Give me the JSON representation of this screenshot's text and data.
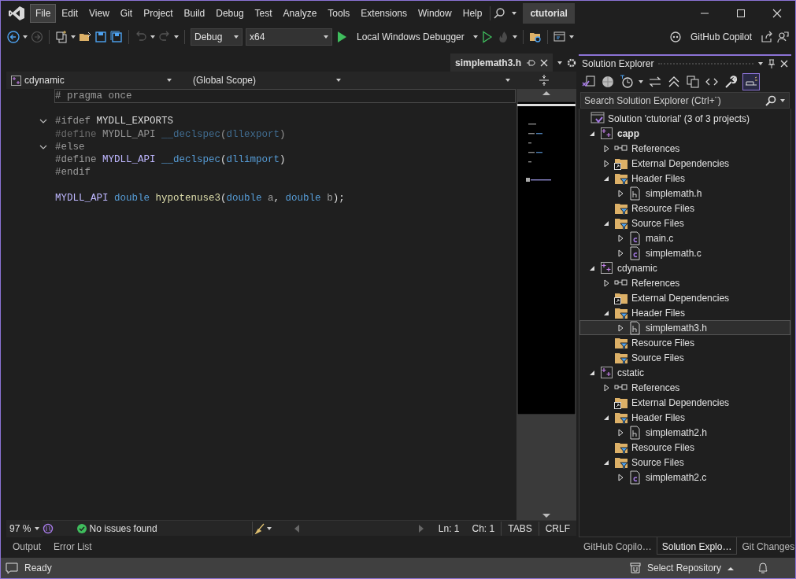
{
  "title_bar": {
    "menu": [
      {
        "label": "File",
        "selected": true
      },
      {
        "label": "Edit",
        "selected": false
      },
      {
        "label": "View",
        "selected": false
      },
      {
        "label": "Git",
        "selected": false
      },
      {
        "label": "Project",
        "selected": false
      },
      {
        "label": "Build",
        "selected": false
      },
      {
        "label": "Debug",
        "selected": false
      },
      {
        "label": "Test",
        "selected": false
      },
      {
        "label": "Analyze",
        "selected": false
      },
      {
        "label": "Tools",
        "selected": false
      },
      {
        "label": "Extensions",
        "selected": false
      },
      {
        "label": "Window",
        "selected": false
      },
      {
        "label": "Help",
        "selected": false
      }
    ],
    "solution_name": "ctutorial"
  },
  "toolbar": {
    "configuration": "Debug",
    "platform": "x64",
    "debugger": "Local Windows Debugger",
    "copilot": "GitHub Copilot"
  },
  "editor": {
    "tab": {
      "label": "simplemath3.h"
    },
    "navigation": [
      "cdynamic",
      "(Global Scope)"
    ],
    "lines": [
      {
        "current": true,
        "tokens": [
          {
            "text": "# pragma once",
            "kind": "preprocessor"
          }
        ]
      },
      {
        "space_before": true,
        "fold": true,
        "tokens": [
          {
            "text": "#ifdef ",
            "kind": "preprocessor"
          },
          {
            "text": "MYDLL_EXPORTS",
            "kind": "identifier"
          }
        ]
      },
      {
        "inactive": true,
        "tokens": [
          {
            "text": "#define ",
            "kind": "preprocessor"
          },
          {
            "text": "MYDLL_API ",
            "kind": "identifier"
          },
          {
            "text": "__declspec",
            "kind": "keyword"
          },
          {
            "text": "(",
            "kind": "plain"
          },
          {
            "text": "dllexport",
            "kind": "keyword"
          },
          {
            "text": ")",
            "kind": "plain"
          }
        ]
      },
      {
        "fold": true,
        "tokens": [
          {
            "text": "#else",
            "kind": "preprocessor"
          }
        ]
      },
      {
        "tokens": [
          {
            "text": "#define ",
            "kind": "preprocessor"
          },
          {
            "text": "MYDLL_API ",
            "kind": "macro"
          },
          {
            "text": "__declspec",
            "kind": "keyword"
          },
          {
            "text": "(",
            "kind": "plain"
          },
          {
            "text": "dllimport",
            "kind": "keyword"
          },
          {
            "text": ")",
            "kind": "plain"
          }
        ]
      },
      {
        "tokens": [
          {
            "text": "#endif",
            "kind": "preprocessor"
          }
        ]
      },
      {
        "space_before": true,
        "tokens": [
          {
            "text": "MYDLL_API ",
            "kind": "macro"
          },
          {
            "text": "double ",
            "kind": "keyword"
          },
          {
            "text": "hypotenuse3",
            "kind": "function"
          },
          {
            "text": "(",
            "kind": "plain"
          },
          {
            "text": "double ",
            "kind": "keyword"
          },
          {
            "text": "a",
            "kind": "parameter"
          },
          {
            "text": ", ",
            "kind": "plain"
          },
          {
            "text": "double ",
            "kind": "keyword"
          },
          {
            "text": "b",
            "kind": "parameter"
          },
          {
            "text": ");",
            "kind": "plain"
          }
        ]
      }
    ],
    "status": {
      "zoom": "97 %",
      "issues": "No issues found",
      "line": "Ln: 1",
      "column": "Ch: 1",
      "indent": "TABS",
      "line_endings": "CRLF"
    }
  },
  "bottom_tabs": [
    {
      "label": "Output"
    },
    {
      "label": "Error List"
    }
  ],
  "solution_explorer": {
    "title": "Solution Explorer",
    "search": {
      "placeholder": "Search Solution Explorer (Ctrl+¨)"
    },
    "tree": [
      {
        "label": "Solution 'ctutorial' (3 of 3 projects)",
        "kind": "solution",
        "selected": false,
        "children": [
          {
            "label": "capp",
            "kind": "project",
            "startup": true,
            "expanded": true,
            "selected": false,
            "children": [
              {
                "label": "References",
                "kind": "references",
                "expanded": false,
                "selected": false
              },
              {
                "label": "External Dependencies",
                "kind": "external",
                "expanded": false,
                "selected": false
              },
              {
                "label": "Header Files",
                "kind": "filter",
                "expanded": true,
                "selected": false,
                "children": [
                  {
                    "label": "simplemath.h",
                    "kind": "header",
                    "expanded": false,
                    "selected": false
                  }
                ]
              },
              {
                "label": "Resource Files",
                "kind": "filter",
                "selected": false
              },
              {
                "label": "Source Files",
                "kind": "filter",
                "expanded": true,
                "selected": false,
                "children": [
                  {
                    "label": "main.c",
                    "kind": "source",
                    "expanded": false,
                    "selected": false
                  },
                  {
                    "label": "simplemath.c",
                    "kind": "source",
                    "expanded": false,
                    "selected": false
                  }
                ]
              }
            ]
          },
          {
            "label": "cdynamic",
            "kind": "project",
            "startup": false,
            "expanded": true,
            "selected": false,
            "children": [
              {
                "label": "References",
                "kind": "references",
                "expanded": false,
                "selected": false
              },
              {
                "label": "External Dependencies",
                "kind": "external",
                "selected": false
              },
              {
                "label": "Header Files",
                "kind": "filter",
                "expanded": true,
                "selected": false,
                "children": [
                  {
                    "label": "simplemath3.h",
                    "kind": "header",
                    "expanded": false,
                    "selected": true
                  }
                ]
              },
              {
                "label": "Resource Files",
                "kind": "filter",
                "selected": false
              },
              {
                "label": "Source Files",
                "kind": "filter",
                "selected": false
              }
            ]
          },
          {
            "label": "cstatic",
            "kind": "project",
            "startup": false,
            "expanded": true,
            "selected": false,
            "children": [
              {
                "label": "References",
                "kind": "references",
                "expanded": false,
                "selected": false
              },
              {
                "label": "External Dependencies",
                "kind": "external",
                "selected": false
              },
              {
                "label": "Header Files",
                "kind": "filter",
                "expanded": true,
                "selected": false,
                "children": [
                  {
                    "label": "simplemath2.h",
                    "kind": "header",
                    "expanded": false,
                    "selected": false
                  }
                ]
              },
              {
                "label": "Resource Files",
                "kind": "filter",
                "selected": false
              },
              {
                "label": "Source Files",
                "kind": "filter",
                "expanded": true,
                "selected": false,
                "children": [
                  {
                    "label": "simplemath2.c",
                    "kind": "source",
                    "expanded": false,
                    "selected": false
                  }
                ]
              }
            ]
          }
        ]
      }
    ],
    "tabs": [
      {
        "label": "GitHub Copilo…",
        "selected": false
      },
      {
        "label": "Solution Explo…",
        "selected": true
      },
      {
        "label": "Git Changes",
        "selected": false
      }
    ]
  },
  "status_bar": {
    "message": "Ready",
    "repository": "Select Repository"
  }
}
